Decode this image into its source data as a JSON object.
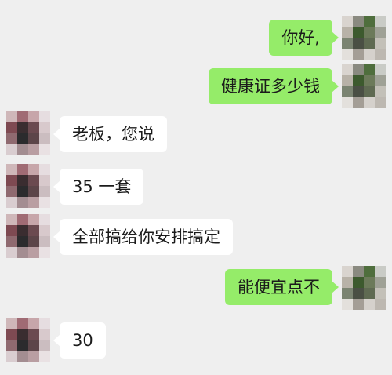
{
  "messages": [
    {
      "side": "out",
      "text": "你好,"
    },
    {
      "side": "out",
      "text": "健康证多少钱"
    },
    {
      "side": "in",
      "text": "老板，您说"
    },
    {
      "side": "in",
      "text": "35 一套"
    },
    {
      "side": "in",
      "text": "全部搞给你安排搞定"
    },
    {
      "side": "out",
      "text": "能便宜点不"
    },
    {
      "side": "in",
      "text": "30"
    }
  ],
  "colors": {
    "background": "#efefef",
    "outgoing_bubble": "#95ec69",
    "incoming_bubble": "#ffffff"
  },
  "avatars": {
    "self": "pixelated-avatar-icon",
    "contact": "pixelated-avatar-icon"
  }
}
